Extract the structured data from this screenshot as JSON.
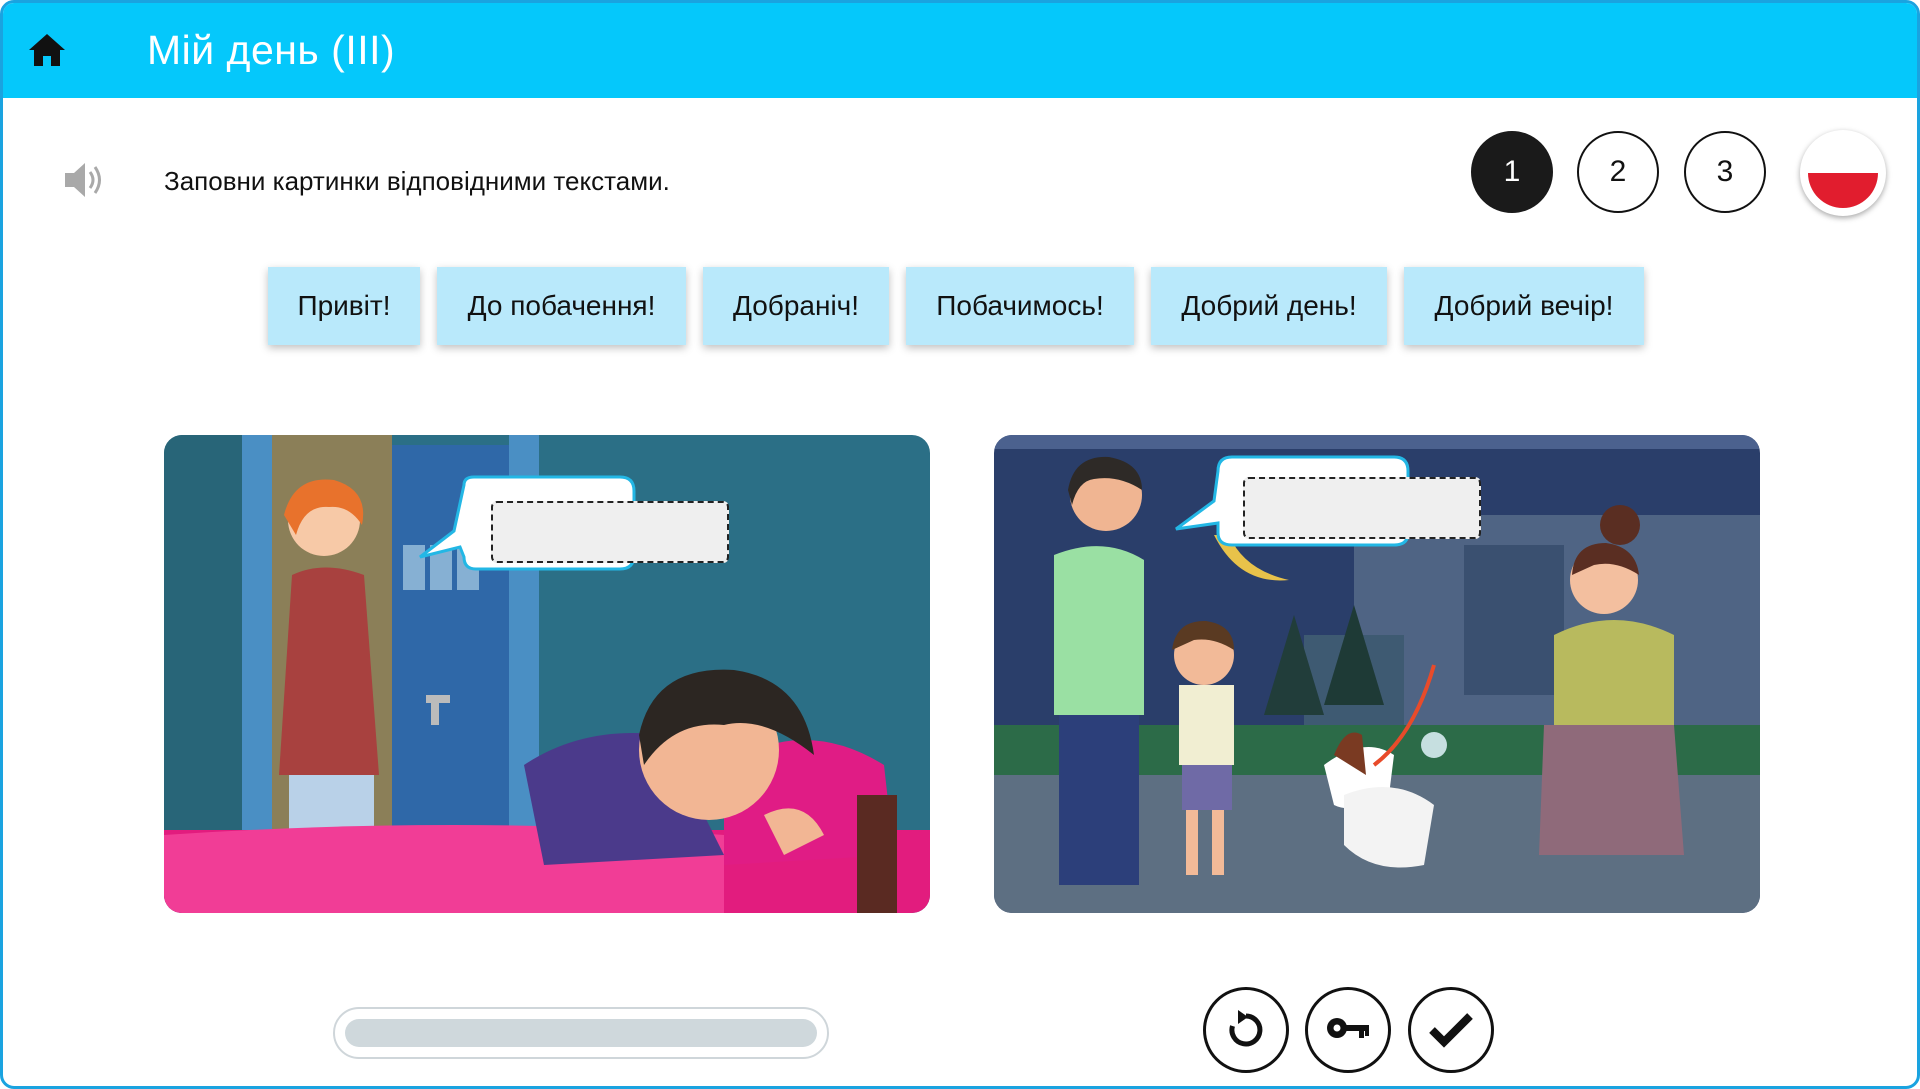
{
  "header": {
    "title": "Мій день (III)",
    "home_icon": "home-icon"
  },
  "instruction": {
    "text": "Заповни картинки відповідними текстами.",
    "audio_icon": "speaker-icon"
  },
  "steps": [
    {
      "label": "1",
      "active": true
    },
    {
      "label": "2",
      "active": false
    },
    {
      "label": "3",
      "active": false
    }
  ],
  "language_flag": {
    "icon": "poland-flag-icon",
    "colors": [
      "#ffffff",
      "#e11d2e"
    ]
  },
  "phrases": [
    "Привіт!",
    "До побачення!",
    "Добраніч!",
    "Побачимось!",
    "Добрий день!",
    "Добрий вечір!"
  ],
  "scenes": [
    {
      "name": "mother-and-sleeping-boy",
      "answer": ""
    },
    {
      "name": "family-meeting-neighbor-with-dog",
      "answer": ""
    }
  ],
  "progress": {
    "value": 0
  },
  "controls": [
    {
      "name": "restart-button",
      "icon": "restart-icon"
    },
    {
      "name": "key-button",
      "icon": "key-icon"
    },
    {
      "name": "check-button",
      "icon": "check-icon"
    }
  ],
  "colors": {
    "header": "#05c8fb",
    "chip": "#b9e9fb",
    "border": "#1aa3e0"
  }
}
